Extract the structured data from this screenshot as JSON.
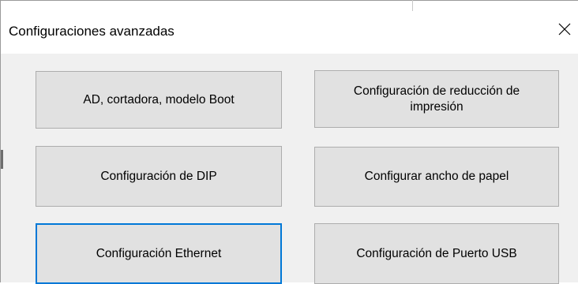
{
  "window": {
    "title": "Configuraciones avanzadas",
    "close_icon": "close-icon"
  },
  "buttons": {
    "ad_cutter_boot": "AD, cortadora, modelo Boot",
    "print_reduction": "Configuración de reducción de impresión",
    "dip_config": "Configuración de DIP",
    "paper_width": "Configurar ancho de papel",
    "ethernet_config": "Configuración Ethernet",
    "usb_port_config": "Configuración de Puerto USB"
  },
  "focused_button": "ethernet_config",
  "colors": {
    "dialog_background": "#f0f0f0",
    "button_background": "#e1e1e1",
    "focus_border": "#0078d7"
  }
}
